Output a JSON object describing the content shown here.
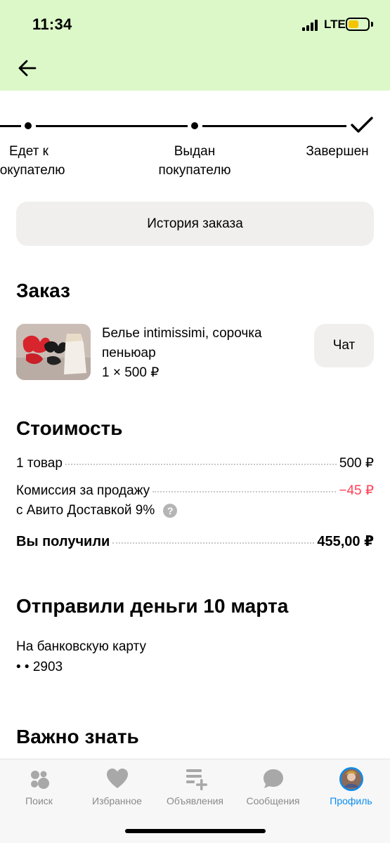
{
  "status_bar": {
    "time": "11:34",
    "network": "LTE",
    "battery_level": 0.55,
    "battery_color": "#f5c400"
  },
  "header": {
    "background": "#dcf8c8",
    "back_icon": "arrow-left-icon"
  },
  "stepper": {
    "steps": [
      {
        "label": "Едет к\nпокупателю",
        "state": "done"
      },
      {
        "label": "Выдан\nпокупателю",
        "state": "done"
      },
      {
        "label": "Завершен",
        "state": "current"
      }
    ]
  },
  "history_button": {
    "label": "История заказа"
  },
  "order": {
    "heading": "Заказ",
    "item_title": "Белье intimissimi, сорочка пеньюар",
    "item_qty": "1 × 500 ₽",
    "chat_label": "Чат"
  },
  "cost": {
    "heading": "Стоимость",
    "items_label": "1 товар",
    "items_value": "500 ₽",
    "commission_label_line1": "Комиссия за продажу",
    "commission_label_line2": "с Авито Доставкой 9%",
    "commission_value": "−45 ₽",
    "commission_color": "#ff3f55",
    "received_label": "Вы получили",
    "received_value": "455,00 ₽"
  },
  "payout": {
    "heading": "Отправили деньги 10 марта",
    "line1": "На банковскую карту",
    "line2": "• • 2903"
  },
  "important": {
    "heading": "Важно знать"
  },
  "tab_bar": {
    "accent_color": "#0a8cf0",
    "tabs": [
      {
        "label": "Поиск",
        "icon": "search-dots-icon",
        "active": false
      },
      {
        "label": "Избранное",
        "icon": "heart-icon",
        "active": false
      },
      {
        "label": "Объявления",
        "icon": "listing-plus-icon",
        "active": false
      },
      {
        "label": "Сообщения",
        "icon": "chat-bubble-icon",
        "active": false
      },
      {
        "label": "Профиль",
        "icon": "avatar-icon",
        "active": true
      }
    ]
  }
}
